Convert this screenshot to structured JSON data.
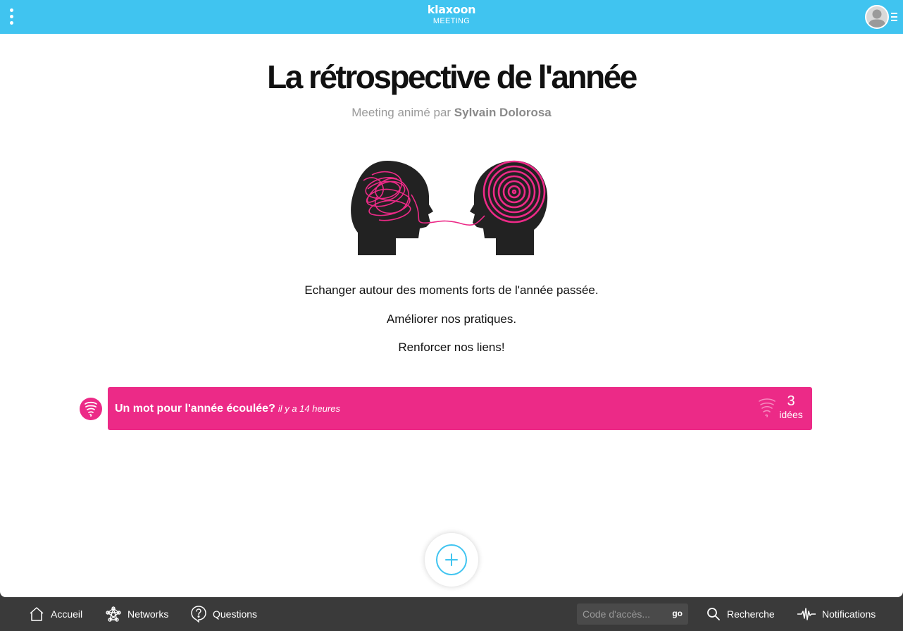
{
  "header": {
    "menu_icon": "vertical-dots-icon",
    "brand": "klaxoon",
    "brand_sub": "MEETING",
    "avatar_icon": "user-avatar-icon"
  },
  "meeting": {
    "title": "La rétrospective de l'année",
    "subtitle_prefix": "Meeting animé par ",
    "host": "Sylvain Dolorosa",
    "description": [
      "Echanger autour des moments forts de l'année passée.",
      "Améliorer nos pratiques.",
      "Renforcer nos liens!"
    ]
  },
  "activity": {
    "icon": "brainstorm-tornado-icon",
    "title": "Un mot pour l'année écoulée?",
    "time": "il y a 14 heures",
    "count": "3",
    "count_label": "idées"
  },
  "add_button_icon": "plus-icon",
  "footer": {
    "nav": [
      {
        "label": "Accueil",
        "icon": "home-icon"
      },
      {
        "label": "Networks",
        "icon": "network-icon"
      },
      {
        "label": "Questions",
        "icon": "question-icon"
      }
    ],
    "code_placeholder": "Code d'accès...",
    "go_label": "go",
    "search_label": "Recherche",
    "notifications_label": "Notifications"
  },
  "colors": {
    "header": "#40c4f0",
    "accent": "#ec2a87",
    "footer": "#3a3a3a"
  }
}
